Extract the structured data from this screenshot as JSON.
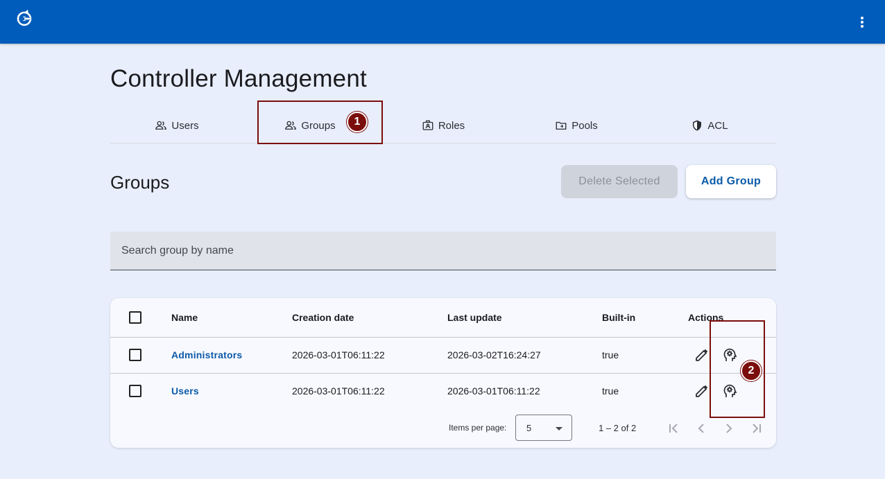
{
  "app": {
    "logo_icon": "app-logo-icon",
    "menu_icon": "more-vertical-icon",
    "brand_color": "#005cbb"
  },
  "page": {
    "title": "Controller Management"
  },
  "tabs": [
    {
      "label": "Users",
      "icon": "user-icon"
    },
    {
      "label": "Groups",
      "icon": "group-icon",
      "active": true
    },
    {
      "label": "Roles",
      "icon": "badge-icon"
    },
    {
      "label": "Pools",
      "icon": "folder-icon"
    },
    {
      "label": "ACL",
      "icon": "shield-icon"
    }
  ],
  "annotations": {
    "a1": "1",
    "a2": "2",
    "color": "#7b0d0d"
  },
  "section": {
    "title": "Groups",
    "delete_label": "Delete Selected",
    "add_label": "Add Group"
  },
  "search": {
    "placeholder": "Search group by name",
    "value": ""
  },
  "table": {
    "columns": [
      "Name",
      "Creation date",
      "Last update",
      "Built-in",
      "Actions"
    ],
    "rows": [
      {
        "name": "Administrators",
        "created": "2026-03-01T06:11:22",
        "updated": "2026-03-02T16:24:27",
        "builtin": "true"
      },
      {
        "name": "Users",
        "created": "2026-03-01T06:11:22",
        "updated": "2026-03-01T06:11:22",
        "builtin": "true"
      }
    ]
  },
  "paginator": {
    "items_per_page_label": "Items per page:",
    "page_size": "5",
    "range_label": "1 – 2 of 2"
  }
}
